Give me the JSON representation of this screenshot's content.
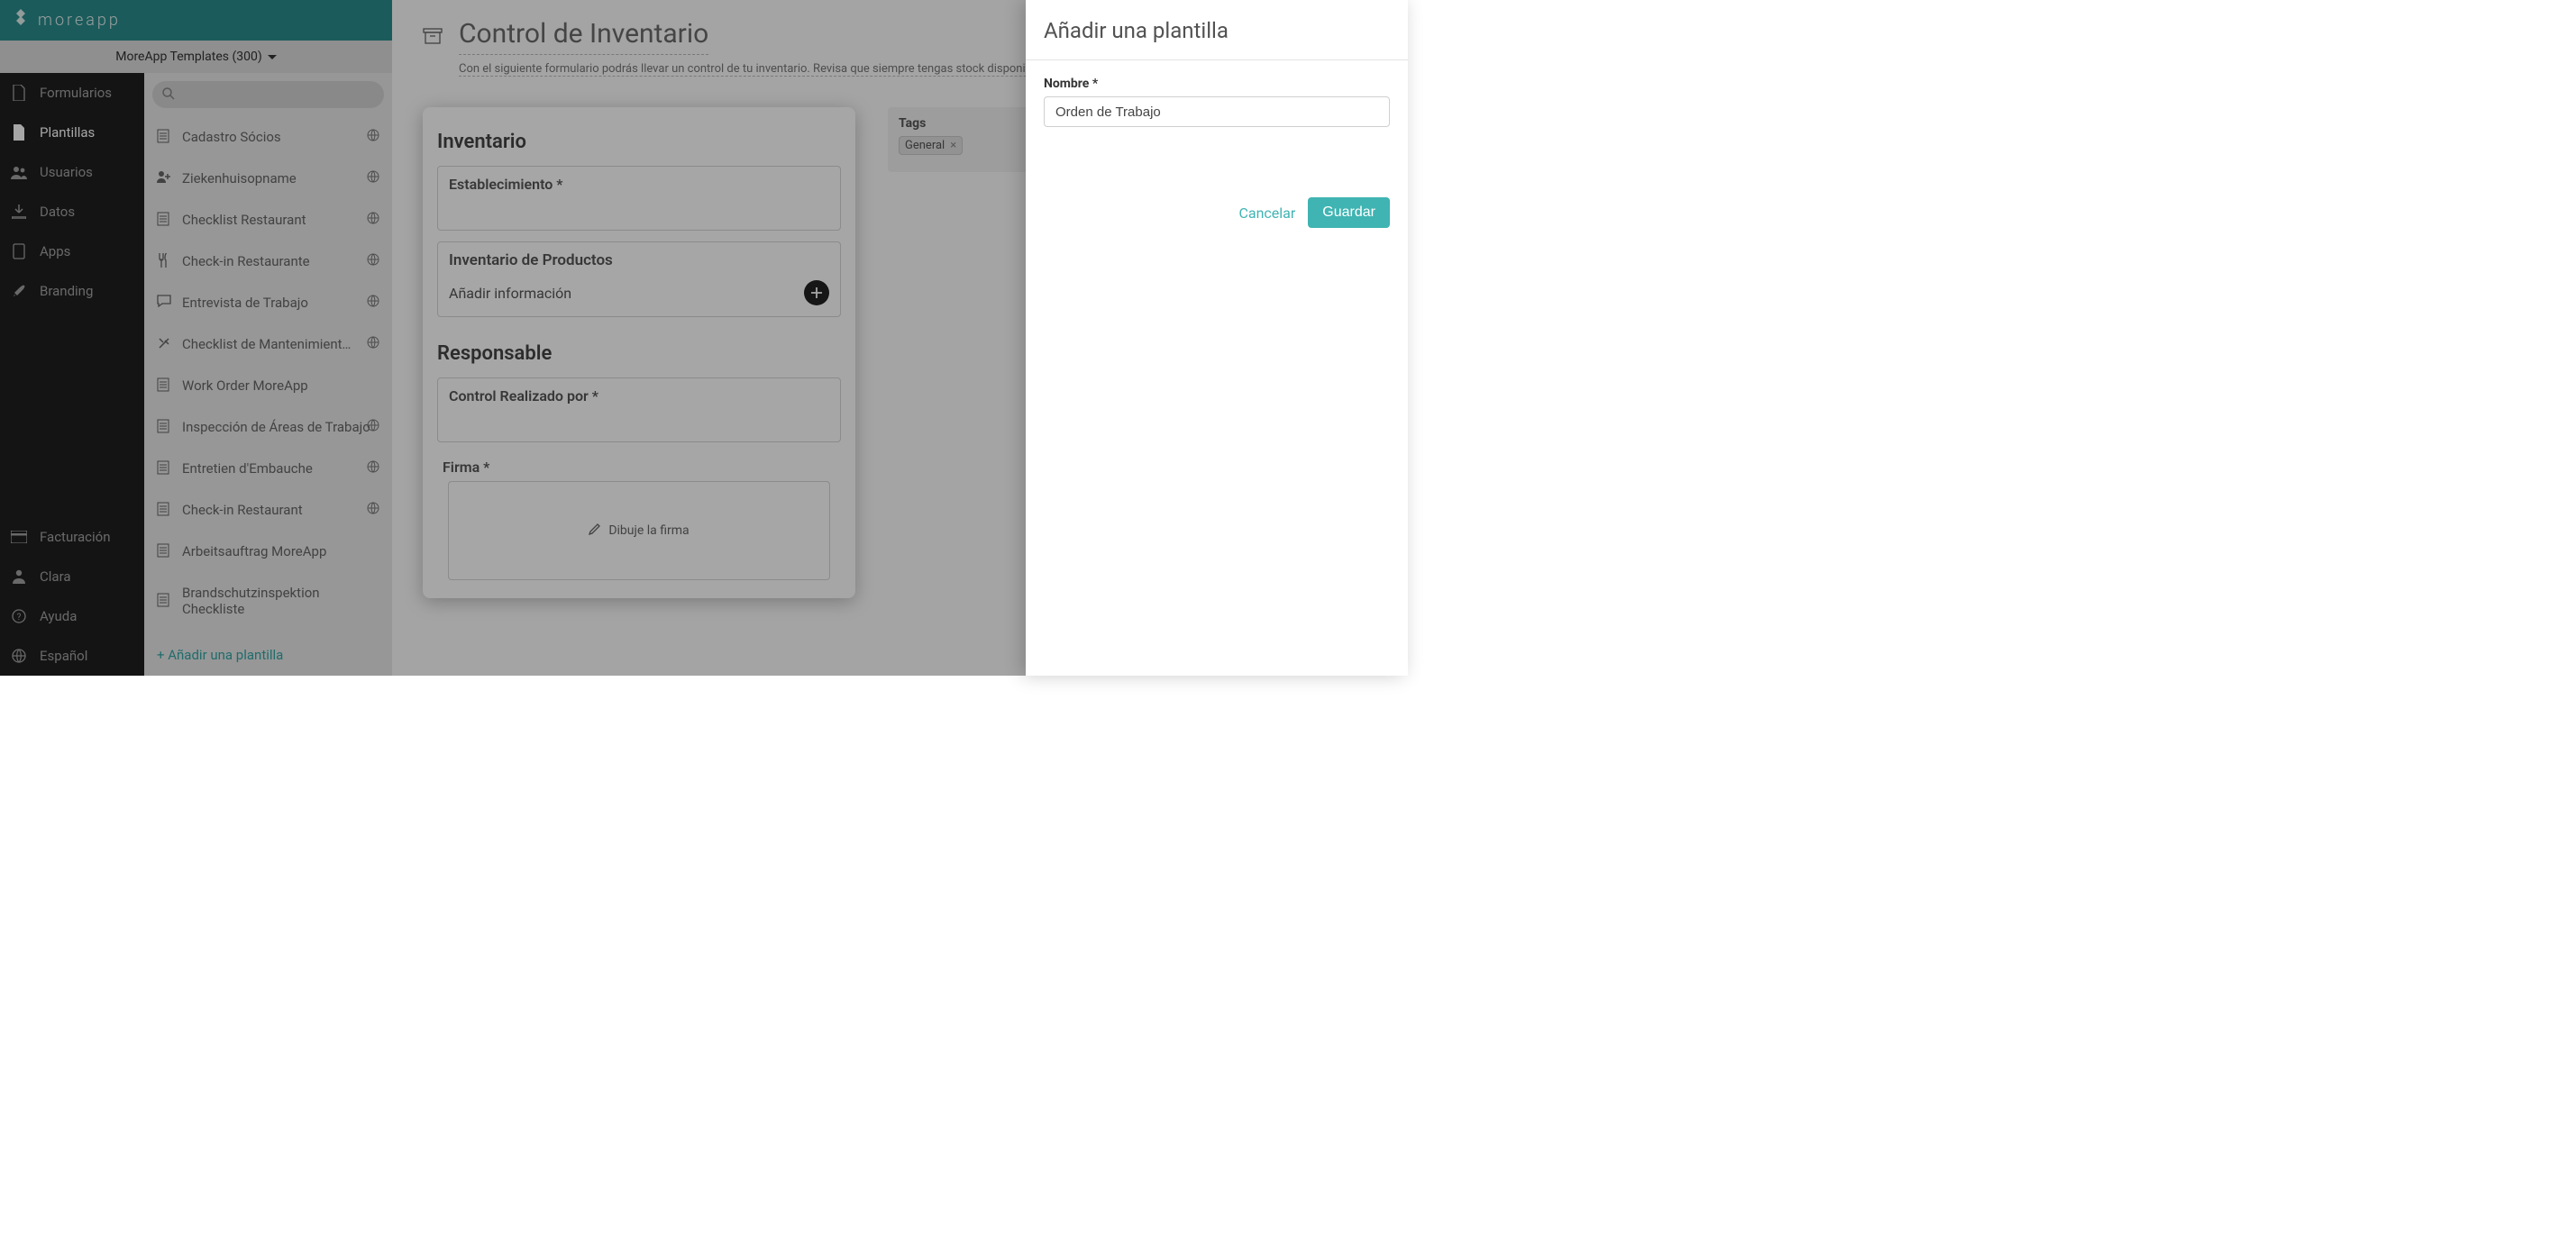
{
  "brand": {
    "name": "moreapp"
  },
  "template_selector": {
    "label": "MoreApp Templates (300)"
  },
  "nav": {
    "items": [
      {
        "id": "formularios",
        "label": "Formularios",
        "icon": "file"
      },
      {
        "id": "plantillas",
        "label": "Plantillas",
        "icon": "file",
        "selected": true
      },
      {
        "id": "usuarios",
        "label": "Usuarios",
        "icon": "users"
      },
      {
        "id": "datos",
        "label": "Datos",
        "icon": "download"
      },
      {
        "id": "apps",
        "label": "Apps",
        "icon": "tablet"
      },
      {
        "id": "branding",
        "label": "Branding",
        "icon": "brush"
      }
    ],
    "bottom": [
      {
        "id": "facturacion",
        "label": "Facturación",
        "icon": "card"
      },
      {
        "id": "clara",
        "label": "Clara",
        "icon": "user"
      },
      {
        "id": "ayuda",
        "label": "Ayuda",
        "icon": "help"
      },
      {
        "id": "idioma",
        "label": "Español",
        "icon": "globe"
      }
    ]
  },
  "templates": {
    "search_placeholder": "",
    "items": [
      {
        "label": "Cadastro Sócios",
        "icon": "doc",
        "global": true
      },
      {
        "label": "Ziekenhuisopname",
        "icon": "user-plus",
        "global": true
      },
      {
        "label": "Checklist Restaurant",
        "icon": "doc",
        "global": true
      },
      {
        "label": "Check-in Restaurante",
        "icon": "utensils",
        "global": true
      },
      {
        "label": "Entrevista de Trabajo",
        "icon": "chat",
        "global": true
      },
      {
        "label": "Checklist de Mantenimiento y Re…",
        "icon": "tools",
        "global": true
      },
      {
        "label": "Work Order MoreApp",
        "icon": "doc",
        "global": false
      },
      {
        "label": "Inspección de Áreas de Trabajo",
        "icon": "doc",
        "global": true
      },
      {
        "label": "Entretien d'Embauche",
        "icon": "doc",
        "global": true
      },
      {
        "label": "Check-in Restaurant",
        "icon": "doc",
        "global": true
      },
      {
        "label": "Arbeitsauftrag MoreApp",
        "icon": "doc",
        "global": false
      },
      {
        "label": "Brandschutzinspektion Checkliste",
        "icon": "doc",
        "global": false
      }
    ],
    "add_label": "+ Añadir una plantilla"
  },
  "main": {
    "title": "Control de Inventario",
    "description": "Con el siguiente formulario podrás llevar un control de tu inventario. Revisa que siempre tengas stock disponible. El responsable po",
    "preview": {
      "section1_title": "Inventario",
      "field1_label": "Establecimiento *",
      "subheading": "Inventario de Productos",
      "add_info": "Añadir información",
      "section2_title": "Responsable",
      "field2_label": "Control Realizado por *",
      "field3_label": "Firma *",
      "sign_hint": "Dibuje la firma"
    },
    "tags": {
      "label": "Tags",
      "chip": "General"
    }
  },
  "modal": {
    "title": "Añadir una plantilla",
    "name_label": "Nombre *",
    "name_value": "Orden de Trabajo",
    "cancel": "Cancelar",
    "save": "Guardar"
  }
}
